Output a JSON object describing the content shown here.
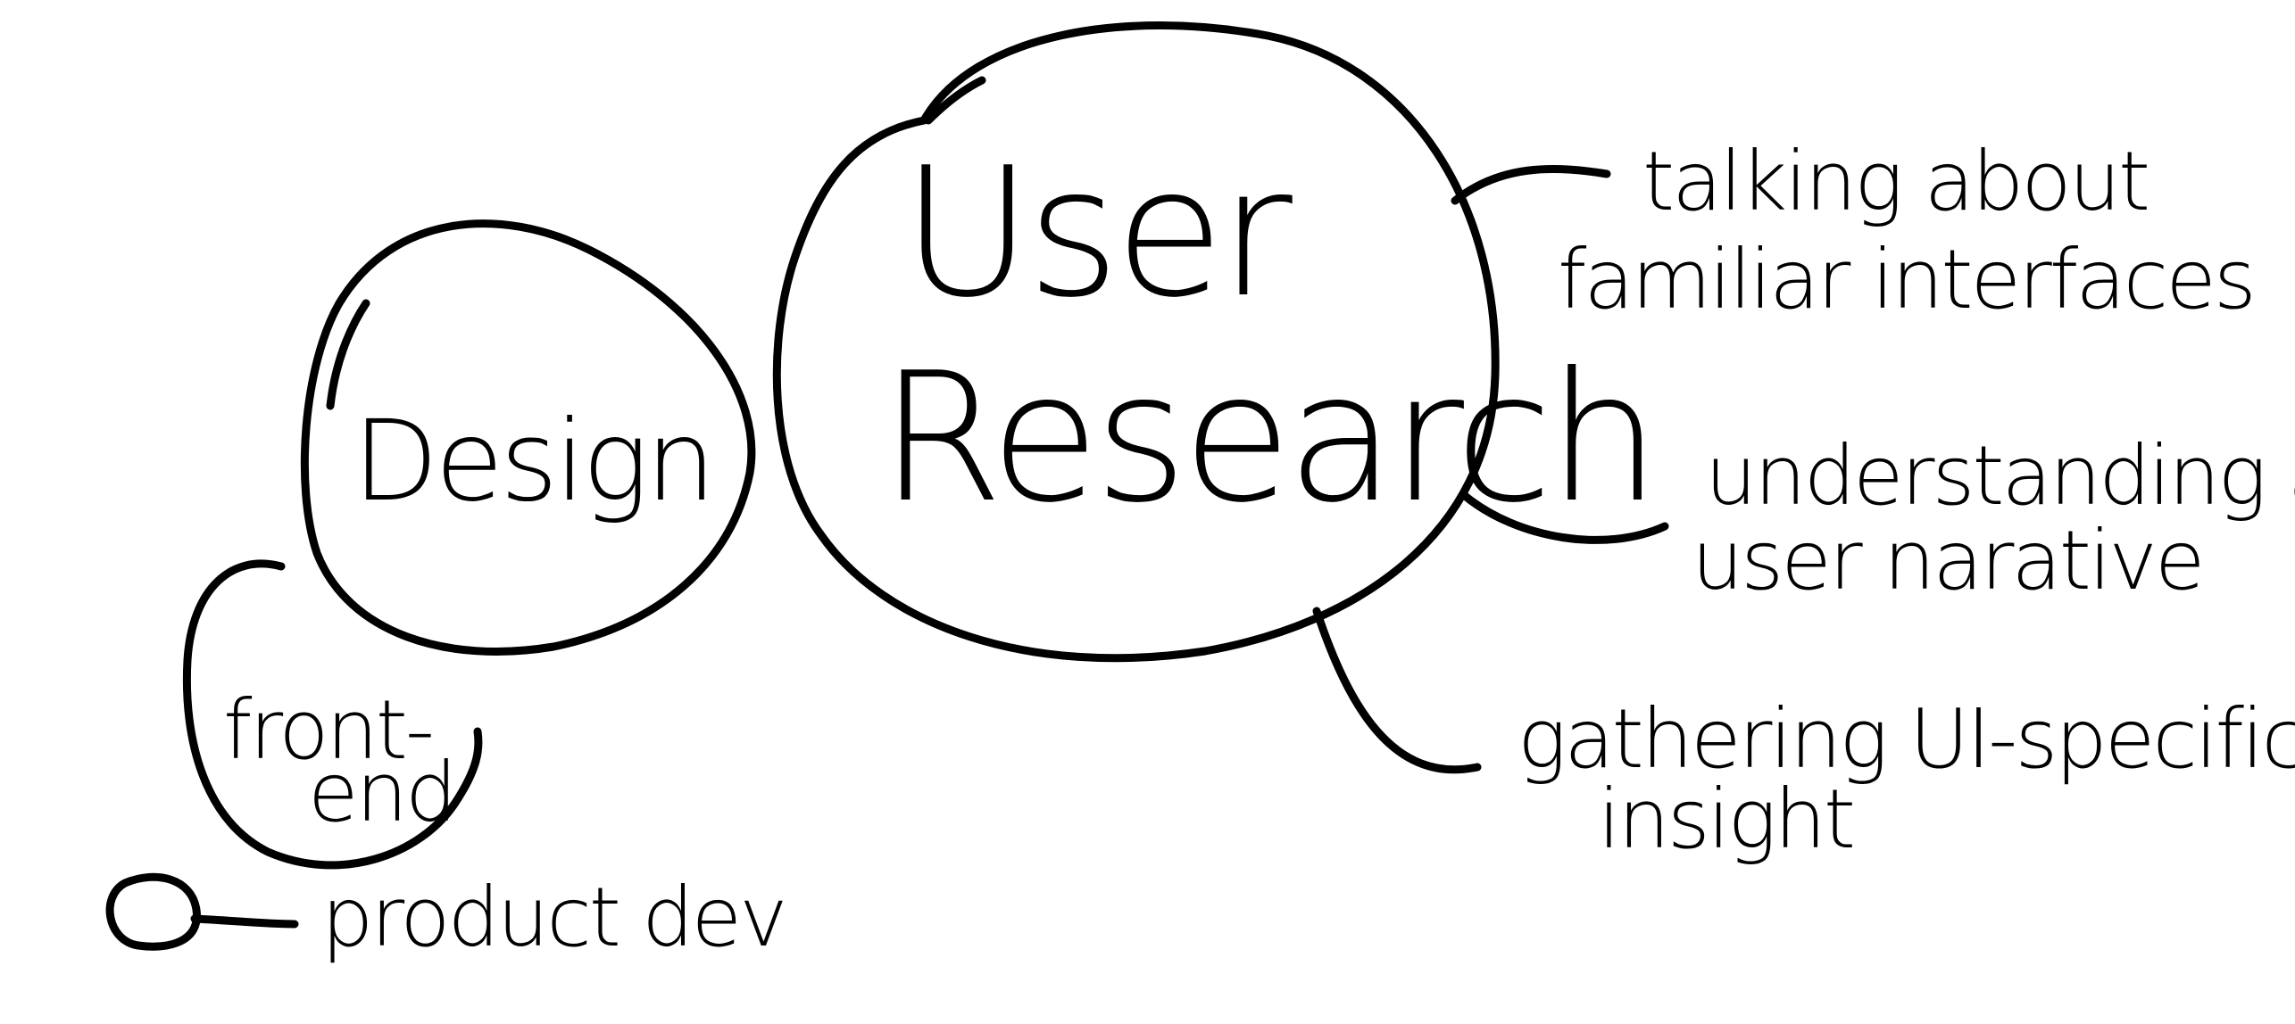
{
  "nodes": {
    "user_research": {
      "line1": "User",
      "line2": "Research"
    },
    "design": {
      "label": "Design"
    },
    "front_end": {
      "line1": "front-",
      "line2": "end"
    },
    "product_dev": {
      "label": "product dev"
    }
  },
  "branches": [
    {
      "line1": "talking about",
      "line2": "familiar interfaces"
    },
    {
      "line1": "understanding a",
      "line2": "user narative"
    },
    {
      "line1": "gathering UI-specific",
      "line2": "insight"
    }
  ]
}
